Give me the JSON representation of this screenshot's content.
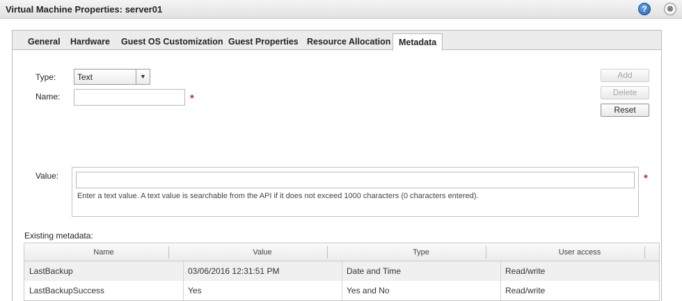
{
  "window": {
    "title": "Virtual Machine Properties: server01",
    "help_icon": "?",
    "close_icon": "⊗"
  },
  "tabs": [
    {
      "label": "General",
      "active": false
    },
    {
      "label": "Hardware",
      "active": false
    },
    {
      "label": "Guest OS Customization",
      "active": false
    },
    {
      "label": "Guest Properties",
      "active": false
    },
    {
      "label": "Resource Allocation",
      "active": false
    },
    {
      "label": "Metadata",
      "active": true
    }
  ],
  "form": {
    "type_label": "Type:",
    "type_value": "Text",
    "type_arrow": "▼",
    "name_label": "Name:",
    "name_value": "",
    "required_mark": "*",
    "value_label": "Value:",
    "value_value": "",
    "value_hint": "Enter a text value. A text value is searchable from the API if it does not exceed 1000 characters (0 characters entered)."
  },
  "actions": {
    "add": "Add",
    "delete": "Delete",
    "reset": "Reset"
  },
  "metadata": {
    "heading": "Existing metadata:",
    "columns": [
      "Name",
      "Value",
      "Type",
      "User access"
    ],
    "rows": [
      [
        "LastBackup",
        "03/06/2016 12:31:51 PM",
        "Date and Time",
        "Read/write"
      ],
      [
        "LastBackupSuccess",
        "Yes",
        "Yes and No",
        "Read/write"
      ]
    ]
  }
}
